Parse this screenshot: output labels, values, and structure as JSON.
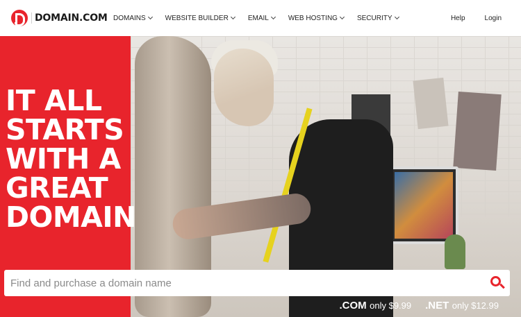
{
  "brand": {
    "name": "DOMAIN.COM",
    "accent": "#e8242c"
  },
  "nav": {
    "items": [
      {
        "label": "DOMAINS"
      },
      {
        "label": "WEBSITE BUILDER"
      },
      {
        "label": "EMAIL"
      },
      {
        "label": "WEB HOSTING"
      },
      {
        "label": "SECURITY"
      }
    ],
    "help": "Help",
    "login": "Login"
  },
  "hero": {
    "headline": [
      "IT ALL",
      "STARTS",
      "WITH A",
      "GREAT",
      "DOMAIN"
    ],
    "search_placeholder": "Find and purchase a domain name",
    "prices": [
      {
        "tld": ".COM",
        "text": "only $9.99"
      },
      {
        "tld": ".NET",
        "text": "only $12.99"
      }
    ]
  }
}
